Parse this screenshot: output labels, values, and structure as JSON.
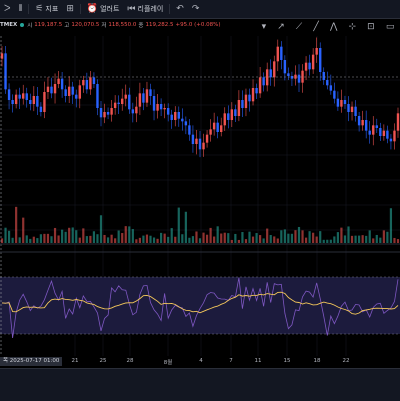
{
  "toolbar": {
    "items": [
      {
        "icon": "chevron-icon",
        "glyph": "ᐳ",
        "label": ""
      },
      {
        "icon": "candles-icon",
        "glyph": "⫴",
        "label": ""
      },
      {
        "icon": "indicator-icon",
        "glyph": "⚟",
        "label": "지표"
      },
      {
        "icon": "grid-icon",
        "glyph": "⊞",
        "label": ""
      },
      {
        "icon": "alert-icon",
        "glyph": "⏰",
        "label": "얼러트"
      },
      {
        "icon": "replay-icon",
        "glyph": "⏮",
        "label": "리플레이"
      },
      {
        "icon": "undo-icon",
        "glyph": "↶",
        "label": ""
      },
      {
        "icon": "redo-icon",
        "glyph": "↷",
        "label": ""
      }
    ]
  },
  "legend": {
    "symbol": "TMEX",
    "o_label": "시",
    "o_value": "119,187.5",
    "h_label": "고",
    "h_value": "120,070.5",
    "l_label": "저",
    "l_value": "118,550.0",
    "c_label": "종",
    "c_value": "119,282.5",
    "change": "+95.0 (+0.08%)"
  },
  "drawing_tools": [
    "▾",
    "↗",
    "⟋",
    "╱",
    "⋀",
    "⊹",
    "⊡",
    "▭"
  ],
  "date_axis": {
    "cursor_label": "목 2025-07-17   01:00",
    "ticks": [
      "21",
      "25",
      "28",
      "8월",
      "4",
      "7",
      "11",
      "15",
      "18",
      "22"
    ]
  },
  "colors": {
    "up": "#ef5350",
    "down": "#2962ff",
    "vol_up": "#26a69a",
    "vol_down": "#ef5350",
    "rsi_line": "#7e57c2",
    "rsi_ma": "#f5c85a",
    "rsi_band": "#1c1b3d"
  },
  "chart_data": {
    "type": "line",
    "close": [
      121.0,
      118.3,
      117.5,
      117.2,
      117.9,
      117.6,
      118.0,
      117.5,
      117.2,
      117.8,
      117.0,
      116.6,
      118.1,
      118.5,
      118.0,
      118.7,
      119.1,
      118.3,
      117.8,
      118.5,
      117.9,
      117.6,
      118.6,
      119.0,
      118.3,
      119.2,
      118.7,
      116.9,
      116.2,
      116.6,
      116.4,
      116.9,
      117.3,
      117.2,
      117.6,
      117.9,
      116.8,
      116.5,
      117.0,
      118.0,
      117.3,
      118.3,
      117.8,
      116.7,
      117.2,
      116.8,
      116.9,
      116.4,
      116.0,
      116.6,
      116.1,
      115.9,
      115.6,
      114.9,
      114.2,
      114.6,
      113.8,
      114.3,
      114.9,
      115.3,
      115.8,
      115.1,
      115.6,
      116.5,
      116.0,
      116.8,
      116.3,
      117.5,
      116.9,
      117.9,
      117.4,
      118.4,
      118.0,
      119.2,
      118.6,
      119.8,
      119.2,
      120.4,
      121.5,
      120.5,
      119.5,
      119.3,
      119.1,
      119.4,
      118.8,
      119.7,
      120.3,
      119.8,
      120.9,
      121.4,
      119.6,
      119.0,
      118.6,
      118.2,
      117.6,
      117.0,
      117.5,
      117.2,
      116.6,
      117.0,
      116.3,
      115.6,
      116.0,
      115.2,
      114.9,
      115.6,
      115.4,
      114.8,
      115.2,
      114.6,
      114.4,
      115.2,
      116.5
    ]
  }
}
